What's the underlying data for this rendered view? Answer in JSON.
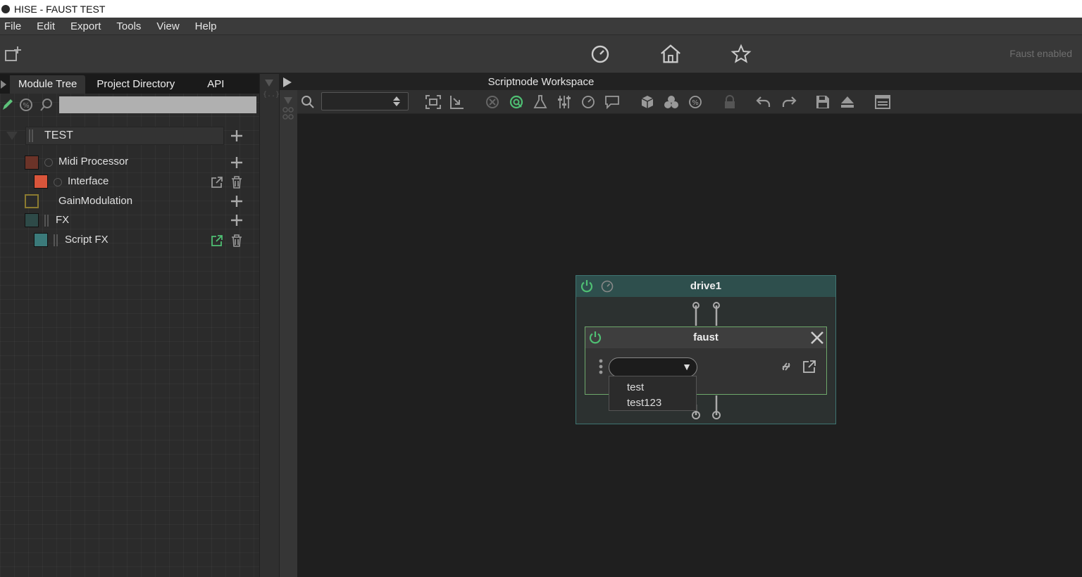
{
  "window": {
    "title": "HISE - FAUST TEST"
  },
  "menu": [
    "File",
    "Edit",
    "Export",
    "Tools",
    "View",
    "Help"
  ],
  "toolbar": {
    "status": "Faust enabled"
  },
  "left_panel": {
    "tabs": [
      "Module Tree",
      "Project Directory",
      "API"
    ],
    "search_placeholder": "",
    "root": "TEST",
    "items": [
      {
        "label": "Midi Processor",
        "color": "#6b3328"
      },
      {
        "label": "Interface",
        "color": "#d9553b"
      },
      {
        "label": "GainModulation",
        "color": "#7a6a2e"
      },
      {
        "label": "FX",
        "color": "#2e4a48"
      },
      {
        "label": "Script FX",
        "color": "#3b7a7a"
      }
    ]
  },
  "workspace": {
    "title": "Scriptnode Workspace",
    "combo_value": "",
    "node": {
      "title": "drive1",
      "child": {
        "title": "faust",
        "combo_value": "",
        "options": [
          "test",
          "test123"
        ]
      }
    }
  },
  "colors": {
    "accent_green": "#4fbf73",
    "node_border": "#6ea86b"
  }
}
